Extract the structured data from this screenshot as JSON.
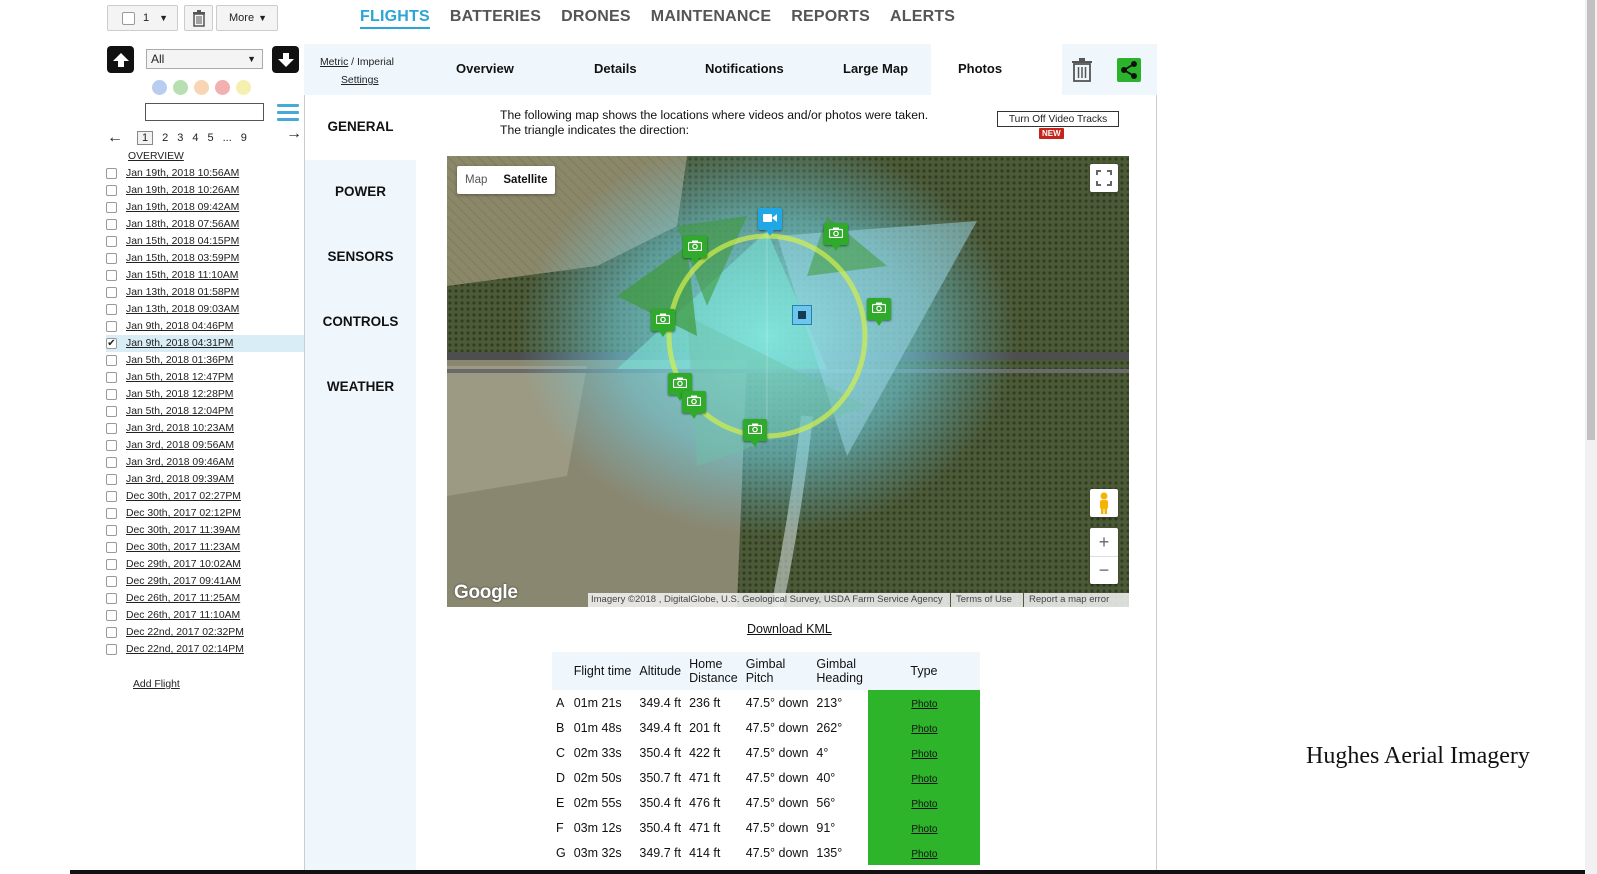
{
  "toolbar": {
    "count": "1",
    "more_label": "More"
  },
  "nav": [
    {
      "label": "FLIGHTS"
    },
    {
      "label": "BATTERIES"
    },
    {
      "label": "DRONES"
    },
    {
      "label": "MAINTENANCE"
    },
    {
      "label": "REPORTS"
    },
    {
      "label": "ALERTS"
    }
  ],
  "filter": {
    "selected": "All"
  },
  "colors": {
    "accent": "#2aa6d6",
    "photo_cell": "#2db42b",
    "new_badge": "#c4261b",
    "dots": [
      "#b9cdf0",
      "#b6e0b0",
      "#f8d5b4",
      "#f2b0b0",
      "#f5f0b0"
    ]
  },
  "pager": {
    "current": "1",
    "pages": [
      "2",
      "3",
      "4",
      "5",
      "...",
      "9"
    ]
  },
  "sidebar": {
    "overview": "OVERVIEW",
    "flights": [
      "Jan 19th, 2018 10:56AM",
      "Jan 19th, 2018 10:26AM",
      "Jan 19th, 2018 09:42AM",
      "Jan 18th, 2018 07:56AM",
      "Jan 15th, 2018 04:15PM",
      "Jan 15th, 2018 03:59PM",
      "Jan 15th, 2018 11:10AM",
      "Jan 13th, 2018 01:58PM",
      "Jan 13th, 2018 09:03AM",
      "Jan 9th, 2018 04:46PM",
      "Jan 9th, 2018 04:31PM",
      "Jan 5th, 2018 01:36PM",
      "Jan 5th, 2018 12:47PM",
      "Jan 5th, 2018 12:28PM",
      "Jan 5th, 2018 12:04PM",
      "Jan 3rd, 2018 10:23AM",
      "Jan 3rd, 2018 09:56AM",
      "Jan 3rd, 2018 09:46AM",
      "Jan 3rd, 2018 09:39AM",
      "Dec 30th, 2017 02:27PM",
      "Dec 30th, 2017 02:12PM",
      "Dec 30th, 2017 11:39AM",
      "Dec 30th, 2017 11:23AM",
      "Dec 29th, 2017 10:02AM",
      "Dec 29th, 2017 09:41AM",
      "Dec 26th, 2017 11:25AM",
      "Dec 26th, 2017 11:10AM",
      "Dec 22nd, 2017 02:32PM",
      "Dec 22nd, 2017 02:14PM"
    ],
    "selected_index": 10,
    "add_flight": "Add Flight"
  },
  "units": {
    "metric": "Metric",
    "sep": " / ",
    "imperial": "Imperial",
    "settings": "Settings"
  },
  "tabs": [
    "Overview",
    "Details",
    "Notifications",
    "Large Map",
    "Photos"
  ],
  "active_tab": "Photos",
  "left_menu": [
    "GENERAL",
    "POWER",
    "SENSORS",
    "CONTROLS",
    "WEATHER"
  ],
  "info": {
    "line1": "The following map shows the locations where videos and/or photos were taken.",
    "line2": "The triangle indicates the direction:",
    "video_button": "Turn Off Video Tracks",
    "new_badge": "NEW"
  },
  "map": {
    "type_map": "Map",
    "type_satellite": "Satellite",
    "logo": "Google",
    "imagery": "Imagery ©2018 , DigitalGlobe, U.S. Geological Survey, USDA Farm Service Agency",
    "terms": "Terms of Use",
    "report": "Report a map error",
    "zoom_in": "+",
    "zoom_out": "−"
  },
  "download_kml": "Download KML",
  "table": {
    "headers": [
      "",
      "Flight time",
      "Altitude",
      "Home Distance",
      "Gimbal Pitch",
      "Gimbal Heading",
      "Type"
    ],
    "rows": [
      [
        "A",
        "01m 21s",
        "349.4 ft",
        "236 ft",
        "47.5° down",
        "213°",
        "Photo"
      ],
      [
        "B",
        "01m 48s",
        "349.4 ft",
        "201 ft",
        "47.5° down",
        "262°",
        "Photo"
      ],
      [
        "C",
        "02m 33s",
        "350.4 ft",
        "422 ft",
        "47.5° down",
        "4°",
        "Photo"
      ],
      [
        "D",
        "02m 50s",
        "350.7 ft",
        "471 ft",
        "47.5° down",
        "40°",
        "Photo"
      ],
      [
        "E",
        "02m 55s",
        "350.4 ft",
        "476 ft",
        "47.5° down",
        "56°",
        "Photo"
      ],
      [
        "F",
        "03m 12s",
        "350.4 ft",
        "471 ft",
        "47.5° down",
        "91°",
        "Photo"
      ],
      [
        "G",
        "03m 32s",
        "349.7 ft",
        "414 ft",
        "47.5° down",
        "135°",
        "Photo"
      ]
    ]
  },
  "watermark": "Hughes Aerial Imagery"
}
